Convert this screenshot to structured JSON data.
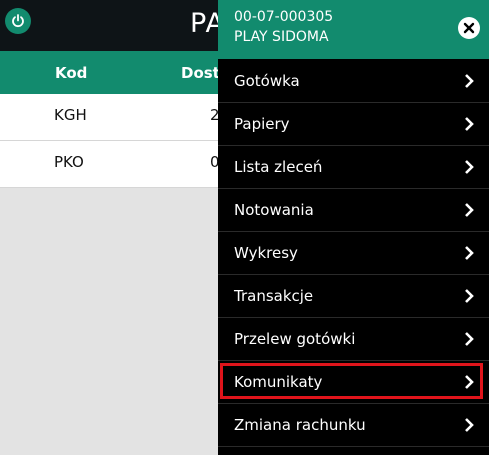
{
  "app": {
    "title": "PA"
  },
  "table": {
    "headers": [
      "Kod",
      "Dosto"
    ],
    "rows": [
      {
        "kod": "KGH",
        "dost": "2"
      },
      {
        "kod": "PKO",
        "dost": "0"
      }
    ]
  },
  "menu": {
    "account_number": "00-07-000305",
    "account_name": "PLAY SIDOMA",
    "items": [
      {
        "label": "Gotówka"
      },
      {
        "label": "Papiery"
      },
      {
        "label": "Lista zleceń"
      },
      {
        "label": "Notowania"
      },
      {
        "label": "Wykresy"
      },
      {
        "label": "Transakcje"
      },
      {
        "label": "Przelew gotówki"
      },
      {
        "label": "Komunikaty",
        "highlighted": true
      },
      {
        "label": "Zmiana rachunku"
      }
    ]
  },
  "colors": {
    "accent": "#128b6e",
    "highlight_border": "#e0141b",
    "menu_background": "#000000"
  },
  "icons": {
    "power": "power-icon",
    "close": "close-icon",
    "chevron": "chevron-right-icon"
  }
}
